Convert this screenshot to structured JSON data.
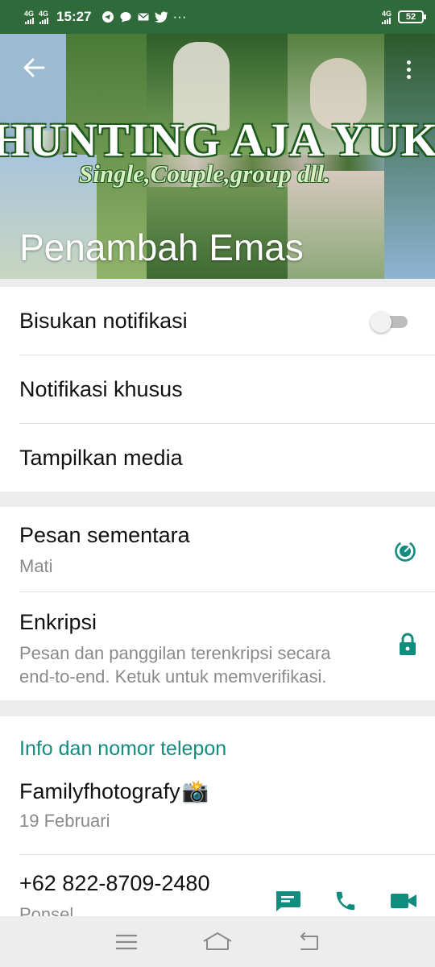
{
  "status_bar": {
    "network1": "4G",
    "network2": "4G",
    "time": "15:27",
    "more": "···",
    "network_right": "4G",
    "battery": "52"
  },
  "header": {
    "banner_title": "HUNTING AJA YUK",
    "banner_subtitle": "Single,Couple,group dll.",
    "group_name": "Penambah Emas"
  },
  "settings": {
    "mute_label": "Bisukan notifikasi",
    "mute_on": false,
    "custom_notif_label": "Notifikasi khusus",
    "media_label": "Tampilkan media"
  },
  "privacy": {
    "disappearing_title": "Pesan sementara",
    "disappearing_value": "Mati",
    "encryption_title": "Enkripsi",
    "encryption_desc_line1": "Pesan dan panggilan terenkripsi secara",
    "encryption_desc_line2": "end-to-end. Ketuk untuk memverifikasi."
  },
  "info": {
    "section_title": "Info dan nomor telepon",
    "about_text": "Familyfhotografy",
    "about_emoji": "📸",
    "about_date": "19 Februari",
    "phone_number": "+62 822-8709-2480",
    "phone_type": "Ponsel"
  },
  "colors": {
    "accent": "#128c7e",
    "status_bar": "#2f6b3a"
  },
  "icons": {
    "back": "arrow-left-icon",
    "menu": "more-vertical-icon",
    "timer": "timer-icon",
    "lock": "lock-icon",
    "message": "message-icon",
    "call": "phone-icon",
    "video": "video-icon"
  }
}
